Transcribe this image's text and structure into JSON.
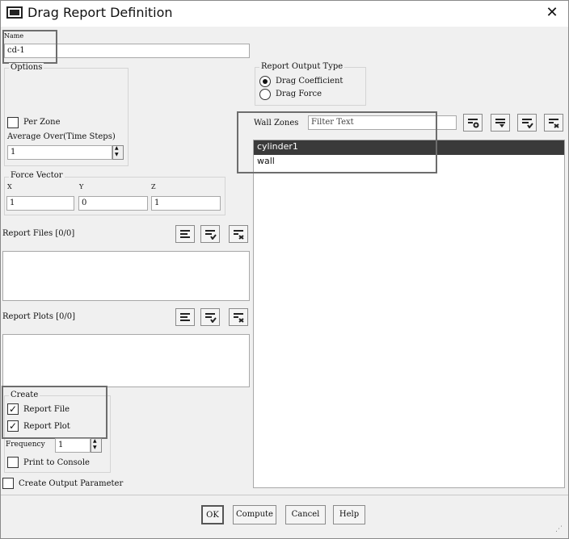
{
  "window": {
    "title": "Drag Report Definition",
    "close": "✕"
  },
  "name": {
    "label": "Name",
    "value": "cd-1"
  },
  "options": {
    "title": "Options",
    "per_zone_label": "Per Zone",
    "per_zone_checked": false,
    "average_over_label": "Average Over(Time Steps)",
    "average_over_value": "1"
  },
  "force_vector": {
    "title": "Force Vector",
    "x_label": "X",
    "y_label": "Y",
    "z_label": "Z",
    "x_value": "1",
    "y_value": "0",
    "z_value": "1"
  },
  "report_files": {
    "label": "Report Files [0/0]"
  },
  "report_plots": {
    "label": "Report Plots [0/0]"
  },
  "create": {
    "title": "Create",
    "report_file_label": "Report File",
    "report_plot_label": "Report Plot",
    "report_file_checked": true,
    "report_plot_checked": true,
    "frequency_label": "Frequency",
    "frequency_value": "1",
    "print_to_console_label": "Print to Console"
  },
  "create_output_parameter_label": "Create Output Parameter",
  "report_output_type": {
    "title": "Report Output Type",
    "options": [
      "Drag Coefficient",
      "Drag Force"
    ],
    "selected": "Drag Coefficient"
  },
  "wall_zones": {
    "label": "Wall Zones",
    "filter_placeholder": "Filter Text",
    "items": [
      "cylinder1",
      "wall"
    ],
    "selected": "cylinder1"
  },
  "buttons": {
    "ok": "OK",
    "compute": "Compute",
    "cancel": "Cancel",
    "help": "Help"
  },
  "colors": {
    "highlight_border": "#6d6d6d",
    "selection_bg": "#3a3a3a"
  }
}
